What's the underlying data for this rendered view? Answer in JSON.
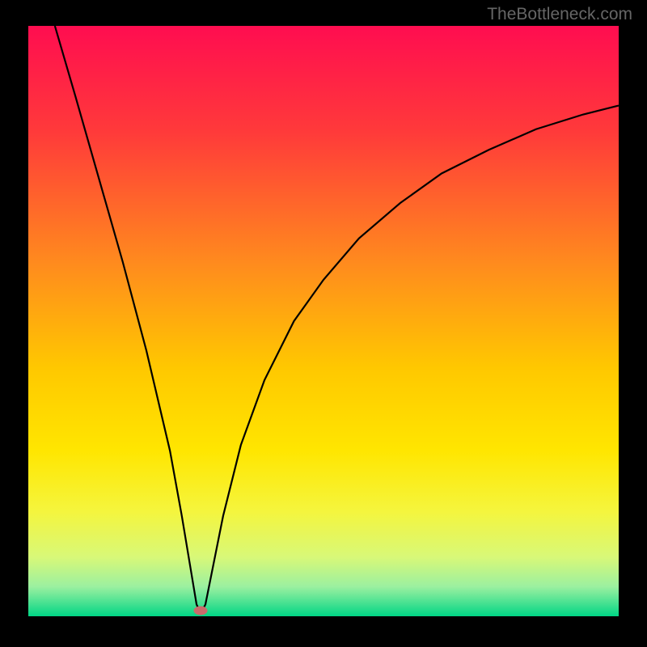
{
  "watermark": "TheBottleneck.com",
  "chart_data": {
    "type": "line",
    "title": "",
    "xlabel": "",
    "ylabel": "",
    "xlim": [
      0,
      100
    ],
    "ylim": [
      0,
      100
    ],
    "gradient_stops": [
      {
        "offset": 0,
        "color": "#ff0d50"
      },
      {
        "offset": 18,
        "color": "#ff3a3a"
      },
      {
        "offset": 40,
        "color": "#ff8a1e"
      },
      {
        "offset": 58,
        "color": "#ffc800"
      },
      {
        "offset": 72,
        "color": "#ffe600"
      },
      {
        "offset": 82,
        "color": "#f5f53c"
      },
      {
        "offset": 90,
        "color": "#d8f878"
      },
      {
        "offset": 95,
        "color": "#9bf0a0"
      },
      {
        "offset": 98,
        "color": "#40e090"
      },
      {
        "offset": 100,
        "color": "#00d685"
      }
    ],
    "series": [
      {
        "name": "bottleneck-curve",
        "description": "V-shaped curve with minimum at x≈29",
        "points": [
          {
            "x": 4.5,
            "y": 100
          },
          {
            "x": 8,
            "y": 88
          },
          {
            "x": 12,
            "y": 74
          },
          {
            "x": 16,
            "y": 60
          },
          {
            "x": 20,
            "y": 45
          },
          {
            "x": 24,
            "y": 28
          },
          {
            "x": 26,
            "y": 17
          },
          {
            "x": 27.5,
            "y": 8
          },
          {
            "x": 28.5,
            "y": 2
          },
          {
            "x": 29.2,
            "y": 0.5
          },
          {
            "x": 30,
            "y": 2
          },
          {
            "x": 31,
            "y": 7
          },
          {
            "x": 33,
            "y": 17
          },
          {
            "x": 36,
            "y": 29
          },
          {
            "x": 40,
            "y": 40
          },
          {
            "x": 45,
            "y": 50
          },
          {
            "x": 50,
            "y": 57
          },
          {
            "x": 56,
            "y": 64
          },
          {
            "x": 63,
            "y": 70
          },
          {
            "x": 70,
            "y": 75
          },
          {
            "x": 78,
            "y": 79
          },
          {
            "x": 86,
            "y": 82.5
          },
          {
            "x": 94,
            "y": 85
          },
          {
            "x": 100,
            "y": 86.5
          }
        ]
      }
    ],
    "marker": {
      "x": 29.2,
      "y": 1,
      "color": "#c96b6b"
    }
  }
}
